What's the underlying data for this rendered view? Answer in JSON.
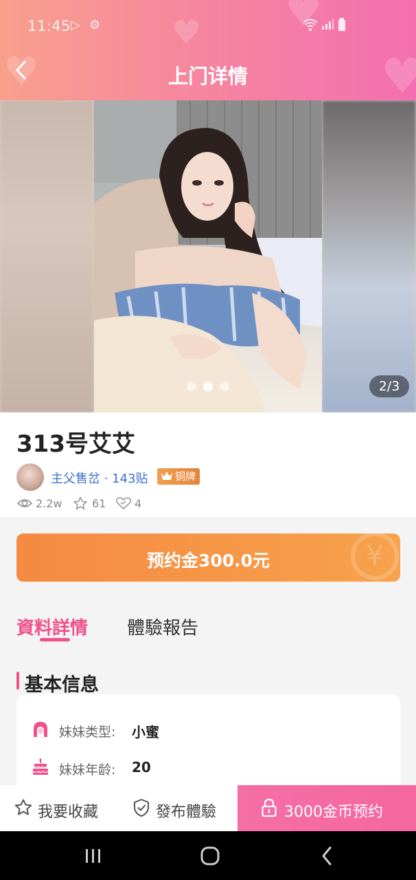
{
  "status_bar": {
    "time": "11:45"
  },
  "header": {
    "title": "上门详情"
  },
  "gallery": {
    "current": 2,
    "total": 3,
    "counter_text": "2/3"
  },
  "profile": {
    "name": "313号艾艾",
    "author": "主父售岔 · 143贴",
    "badge": "铜牌",
    "views": "2.2w",
    "favorites": "61",
    "likes": "4"
  },
  "deposit": {
    "label": "预约金300.0元"
  },
  "tabs": [
    {
      "label": "資料詳情",
      "active": true
    },
    {
      "label": "體驗報告",
      "active": false
    }
  ],
  "basic_info": {
    "title": "基本信息",
    "rows": [
      {
        "icon": "girl-icon",
        "label": "妹妹类型:",
        "value": "小蜜"
      },
      {
        "icon": "cake-icon",
        "label": "妹妹年龄:",
        "value": "20"
      }
    ]
  },
  "actions": {
    "favorite": "我要收藏",
    "publish": "發布體驗",
    "book": "3000金币预约"
  },
  "colors": {
    "accent": "#f0508a",
    "header_start": "#f8a08c",
    "header_end": "#f46fb0",
    "deposit": "#f58a42",
    "author_link": "#3f6fd3"
  }
}
